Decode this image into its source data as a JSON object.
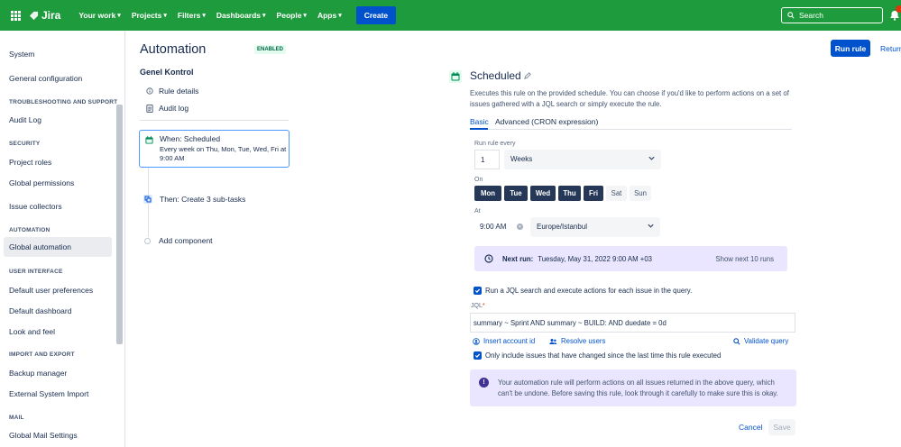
{
  "topnav": {
    "logo": "Jira",
    "items": [
      {
        "label": "Your work"
      },
      {
        "label": "Projects"
      },
      {
        "label": "Filters"
      },
      {
        "label": "Dashboards"
      },
      {
        "label": "People"
      },
      {
        "label": "Apps"
      }
    ],
    "create_label": "Create",
    "search_placeholder": "Search",
    "brand_color": "#1e9b3d"
  },
  "sidebar": {
    "title": "System",
    "general_configuration": "General configuration",
    "section_troubleshooting": "TROUBLESHOOTING AND SUPPORT",
    "audit_log": "Audit Log",
    "section_security": "SECURITY",
    "project_roles": "Project roles",
    "global_permissions": "Global permissions",
    "issue_collectors": "Issue collectors",
    "section_automation": "AUTOMATION",
    "global_automation": "Global automation",
    "section_ui": "USER INTERFACE",
    "default_user_preferences": "Default user preferences",
    "default_dashboard": "Default dashboard",
    "look_and_feel": "Look and feel",
    "section_import": "IMPORT AND EXPORT",
    "backup_manager": "Backup manager",
    "external_system_import": "External System Import",
    "section_mail": "MAIL",
    "global_mail_settings": "Global Mail Settings"
  },
  "header": {
    "title": "Automation",
    "status": "ENABLED",
    "run_rule": "Run rule",
    "return": "Return"
  },
  "rule": {
    "name": "Genel Kontrol",
    "details": "Rule details",
    "audit": "Audit log",
    "when_title": "When: Scheduled",
    "when_sub": "Every week on Thu, Mon, Tue, Wed, Fri at 9:00 AM",
    "then": "Then: Create 3 sub-tasks",
    "add": "Add component"
  },
  "config": {
    "title": "Scheduled",
    "description": "Executes this rule on the provided schedule. You can choose if you'd like to perform actions on a set of issues gathered with a JQL search or simply execute the rule.",
    "tab_basic": "Basic",
    "tab_advanced": "Advanced (CRON expression)",
    "run_every_label": "Run rule every",
    "run_every_value": "1",
    "period": "Weeks",
    "on_label": "On",
    "days": [
      {
        "label": "Mon",
        "on": true
      },
      {
        "label": "Tue",
        "on": true
      },
      {
        "label": "Wed",
        "on": true
      },
      {
        "label": "Thu",
        "on": true
      },
      {
        "label": "Fri",
        "on": true
      },
      {
        "label": "Sat",
        "on": false
      },
      {
        "label": "Sun",
        "on": false
      }
    ],
    "at_label": "At",
    "time": "9:00 AM",
    "timezone": "Europe/Istanbul",
    "next_run_label": "Next run:",
    "next_run_value": "Tuesday, May 31, 2022 9:00 AM +03",
    "show_next": "Show next 10 runs",
    "jql_check_label": "Run a JQL search and execute actions for each issue in the query.",
    "jql_label": "JQL",
    "jql_required": "*",
    "jql_value": "summary ~ Sprint AND summary ~ BUILD: AND duedate = 0d",
    "insert_account_id": "Insert account id",
    "resolve_users": "Resolve users",
    "validate_query": "Validate query",
    "only_changed_label": "Only include issues that have changed since the last time this rule executed",
    "warning": "Your automation rule will perform actions on all issues returned in the above query, which can't be undone. Before saving this rule, look through it carefully to make sure this is okay.",
    "cancel": "Cancel",
    "save": "Save"
  }
}
